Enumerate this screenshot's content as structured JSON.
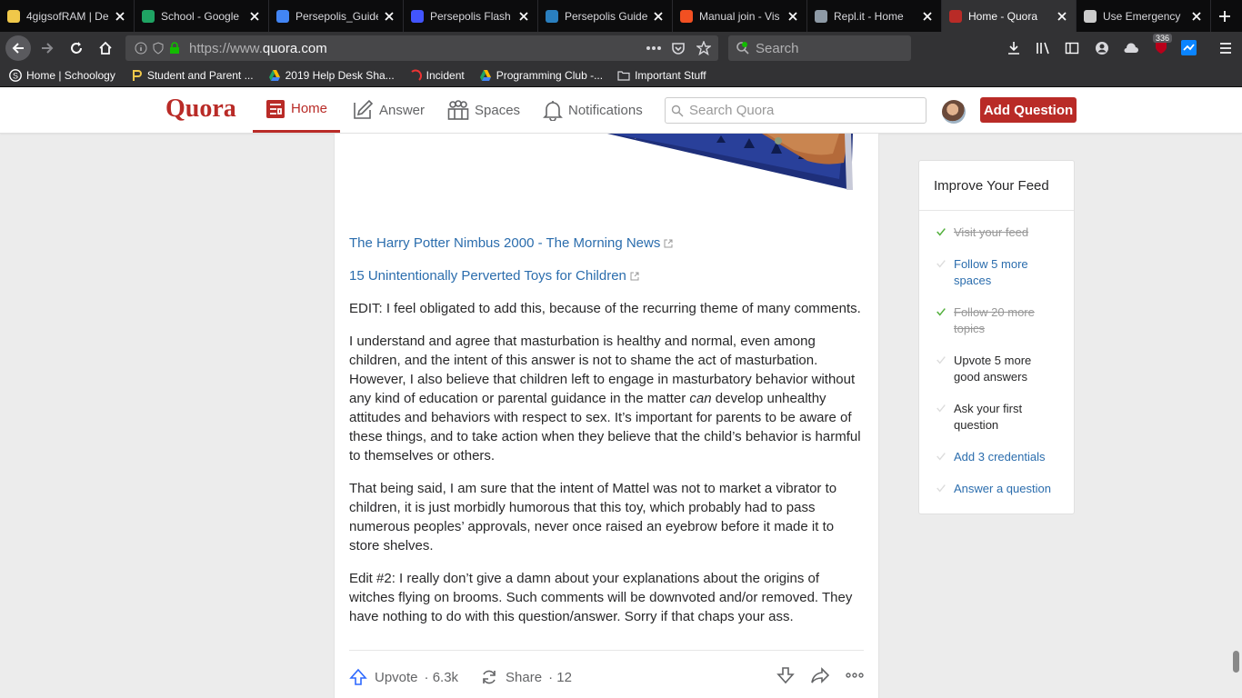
{
  "browser": {
    "tabs": [
      {
        "title": "4gigsofRAM | De",
        "favicon_color": "#f0c84a",
        "active": false
      },
      {
        "title": "School - Google",
        "favicon_color": "#1fa463",
        "active": false
      },
      {
        "title": "Persepolis_Guide",
        "favicon_color": "#4285f4",
        "active": false
      },
      {
        "title": "Persepolis Flash",
        "favicon_color": "#4255ff",
        "active": false
      },
      {
        "title": "Persepolis Guide",
        "favicon_color": "#2a7fbf",
        "active": false
      },
      {
        "title": "Manual join - Vis",
        "favicon_color": "#f25022",
        "active": false
      },
      {
        "title": "Repl.it - Home",
        "favicon_color": "#8e9aa6",
        "active": false
      },
      {
        "title": "Home - Quora",
        "favicon_color": "#b92b27",
        "active": true
      },
      {
        "title": "Use Emergency",
        "favicon_color": "#cccccc",
        "active": false
      }
    ],
    "url_prefix": "https://www.",
    "url_host": "quora.com",
    "search_placeholder": "Search",
    "badge_count": "336",
    "bookmarks": [
      {
        "label": "Home | Schoology"
      },
      {
        "label": "Student and Parent ..."
      },
      {
        "label": "2019 Help Desk Sha..."
      },
      {
        "label": "Incident"
      },
      {
        "label": "Programming Club -..."
      },
      {
        "label": "Important Stuff"
      }
    ]
  },
  "quora": {
    "logo": "Quora",
    "nav": {
      "home": "Home",
      "answer": "Answer",
      "spaces": "Spaces",
      "notifications": "Notifications"
    },
    "search_placeholder": "Search Quora",
    "add_question": "Add Question",
    "brand_color": "#b92b27",
    "link_color": "#2b6dad"
  },
  "answer": {
    "links": [
      "The Harry Potter Nimbus 2000 - The Morning News",
      "15 Unintentionally Perverted Toys for Children"
    ],
    "paragraphs": {
      "edit1": "EDIT: I feel obligated to add this, because of the recurring theme of many comments.",
      "p2_before": "I understand and agree that masturbation is healthy and normal, even among children, and the intent of this answer is not to shame the act of masturbation. However, I also believe that children left to engage in masturbatory behavior without any kind of education or parental guidance in the matter ",
      "p2_emph": "can",
      "p2_after": " develop unhealthy attitudes and behaviors with respect to sex. It’s important for parents to be aware of these things, and to take action when they believe that the child’s behavior is harmful to themselves or others.",
      "p3": "That being said, I am sure that the intent of Mattel was not to market a vibrator to children, it is just morbidly humorous that this toy, which probably had to pass numerous peoples’ approvals, never once raised an eyebrow before it made it to store shelves.",
      "p4": "Edit #2: I really don’t give a damn about your explanations about the origins of witches flying on brooms. Such comments will be downvoted and/or removed. They have nothing to do with this question/answer. Sorry if that chaps your ass."
    },
    "actions": {
      "upvote": "Upvote",
      "upvote_count": "· 6.3k",
      "share": "Share",
      "share_count": "· 12"
    }
  },
  "sidebar": {
    "title": "Improve Your Feed",
    "items": [
      {
        "label": "Visit your feed",
        "state": "done"
      },
      {
        "label": "Follow 5 more spaces",
        "state": "link"
      },
      {
        "label": "Follow 20 more topics",
        "state": "done"
      },
      {
        "label": "Upvote 5 more good answers",
        "state": "plain"
      },
      {
        "label": "Ask your first question",
        "state": "plain"
      },
      {
        "label": "Add 3 credentials",
        "state": "link"
      },
      {
        "label": "Answer a question",
        "state": "link"
      }
    ]
  }
}
